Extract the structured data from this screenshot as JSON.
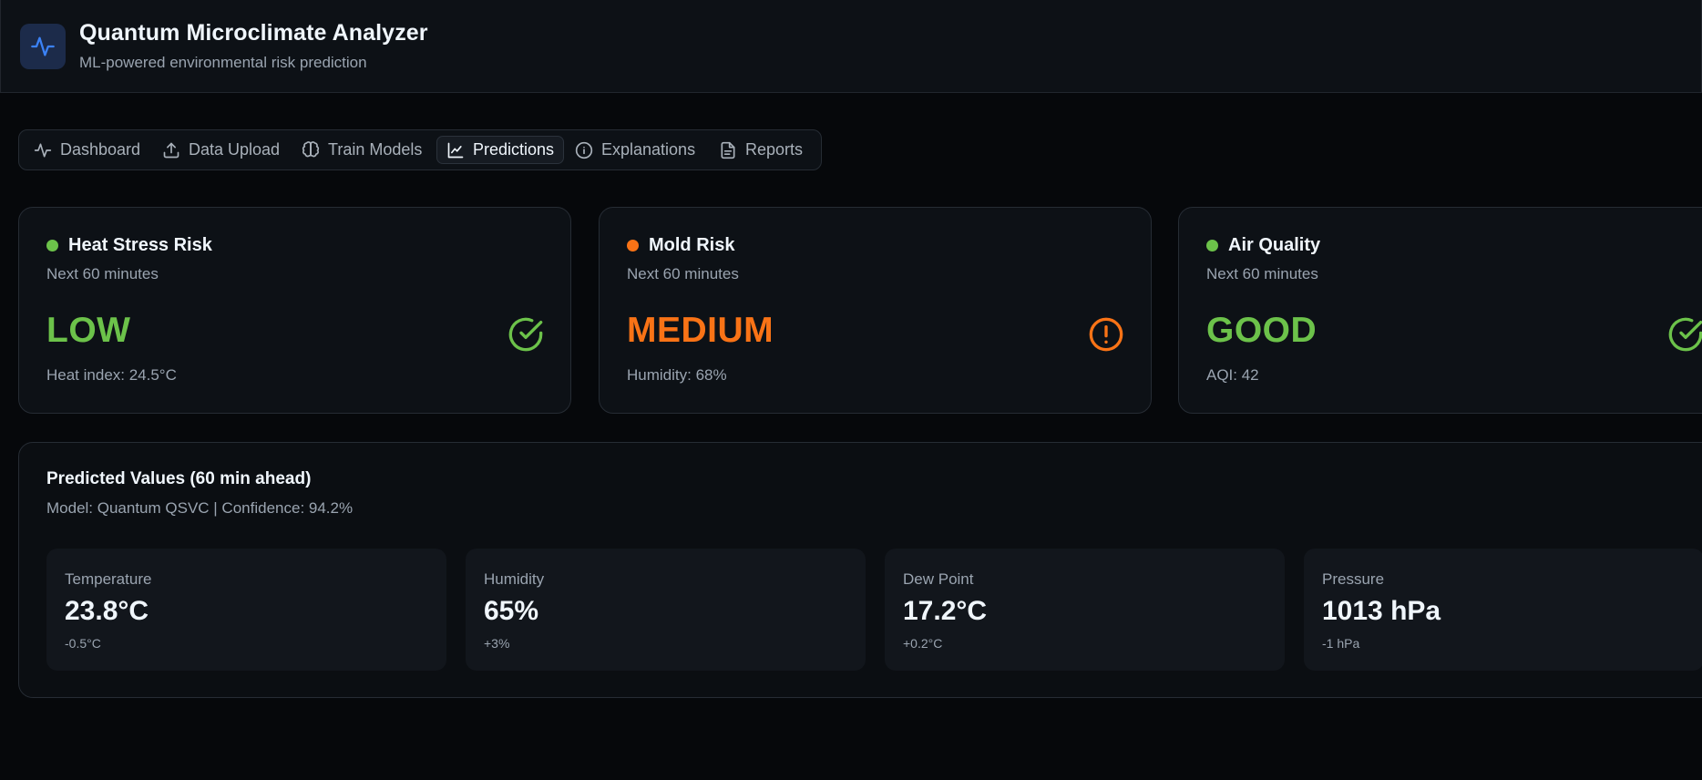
{
  "header": {
    "title": "Quantum Microclimate Analyzer",
    "subtitle": "ML-powered environmental risk prediction",
    "logo_icon": "activity-pulse-icon",
    "accent": "#3b82f6"
  },
  "nav": {
    "items": [
      {
        "label": "Dashboard",
        "icon": "activity-icon",
        "active": false
      },
      {
        "label": "Data Upload",
        "icon": "upload-icon",
        "active": false
      },
      {
        "label": "Train Models",
        "icon": "brain-icon",
        "active": false
      },
      {
        "label": "Predictions",
        "icon": "line-chart-icon",
        "active": true
      },
      {
        "label": "Explanations",
        "icon": "info-icon",
        "active": false
      },
      {
        "label": "Reports",
        "icon": "document-icon",
        "active": false
      }
    ]
  },
  "risks": [
    {
      "title": "Heat Stress Risk",
      "horizon": "Next 60 minutes",
      "level": "LOW",
      "detail": "Heat index: 24.5°C",
      "color": "#6cc24a",
      "icon": "check-circle-icon"
    },
    {
      "title": "Mold Risk",
      "horizon": "Next 60 minutes",
      "level": "MEDIUM",
      "detail": "Humidity: 68%",
      "color": "#f97316",
      "icon": "alert-circle-icon"
    },
    {
      "title": "Air Quality",
      "horizon": "Next 60 minutes",
      "level": "GOOD",
      "detail": "AQI: 42",
      "color": "#6cc24a",
      "icon": "check-circle-icon"
    }
  ],
  "predictions": {
    "title": "Predicted Values (60 min ahead)",
    "subtitle": "Model: Quantum QSVC | Confidence: 94.2%",
    "metrics": [
      {
        "label": "Temperature",
        "value": "23.8°C",
        "delta": "-0.5°C"
      },
      {
        "label": "Humidity",
        "value": "65%",
        "delta": "+3%"
      },
      {
        "label": "Dew Point",
        "value": "17.2°C",
        "delta": "+0.2°C"
      },
      {
        "label": "Pressure",
        "value": "1013 hPa",
        "delta": "-1 hPa"
      }
    ]
  }
}
